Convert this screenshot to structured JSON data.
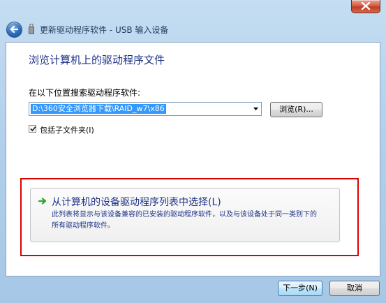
{
  "window": {
    "title": "更新驱动程序软件 - USB 输入设备"
  },
  "page": {
    "heading": "浏览计算机上的驱动程序文件",
    "search_label": "在以下位置搜索驱动程序软件:",
    "path_value": "D:\\360安全浏览器下载\\RAID_w7\\x86",
    "browse_label": "浏览(R)...",
    "include_subfolders_label": "包括子文件夹(I)",
    "include_subfolders_checked": true
  },
  "pick_option": {
    "title": "从计算机的设备驱动程序列表中选择(L)",
    "description_line1": "此列表将显示与该设备兼容的已安装的驱动程序软件，以及与该设备处于同一类别下的",
    "description_line2": "所有驱动程序软件。"
  },
  "footer": {
    "next_label": "下一步(N)",
    "cancel_label": "取消"
  },
  "icons": {
    "close": "close-icon",
    "back": "back-arrow-icon",
    "usb": "usb-device-icon",
    "dropdown": "chevron-down-icon",
    "option_arrow": "green-arrow-icon"
  },
  "colors": {
    "heading": "#1e3287",
    "selection": "#3399ff",
    "highlight_annotation": "#e00000",
    "close_button": "#c23b22",
    "option_arrow": "#2ea82e"
  }
}
